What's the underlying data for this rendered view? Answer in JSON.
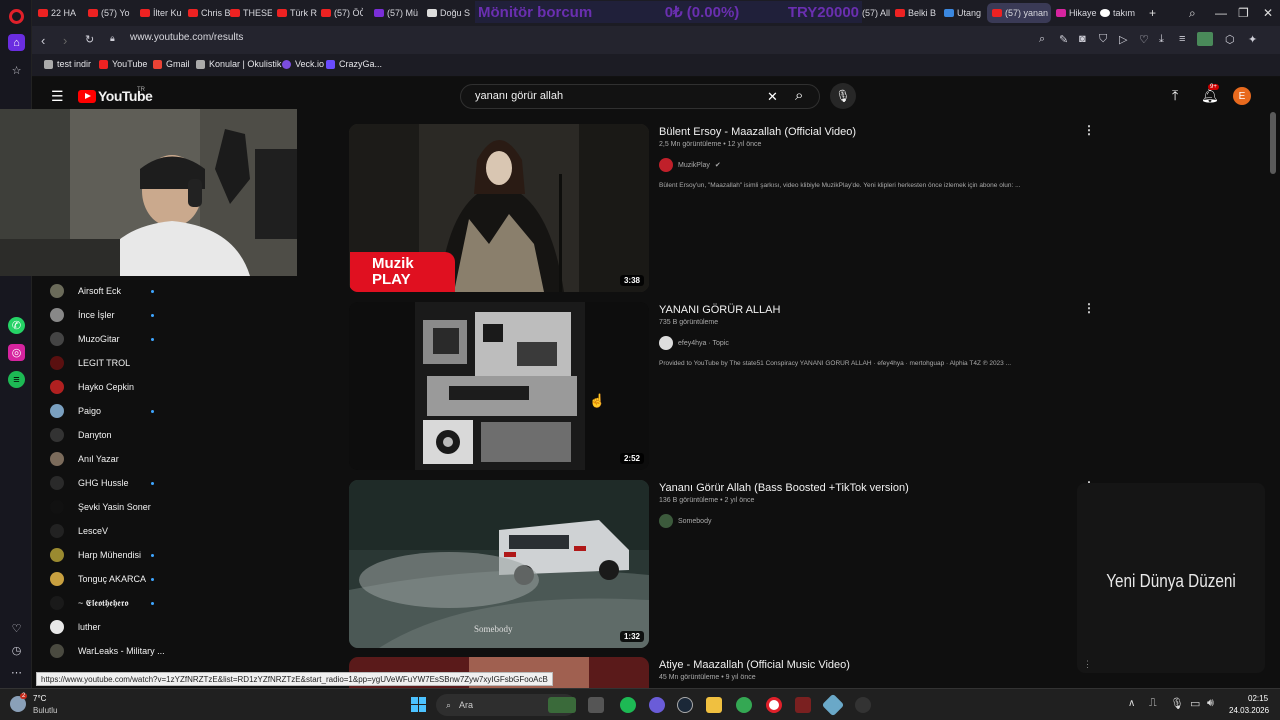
{
  "browser": {
    "tabs": [
      {
        "label": "22 HA"
      },
      {
        "label": "(57) Yo"
      },
      {
        "label": "İlter Ku"
      },
      {
        "label": "Chris B"
      },
      {
        "label": "THESE"
      },
      {
        "label": "Türk R"
      },
      {
        "label": "(57) ÖĞ"
      },
      {
        "label": "(57) Mü"
      },
      {
        "label": "Doğu S"
      },
      {
        "label": "(57) All"
      },
      {
        "label": "Belki B"
      },
      {
        "label": "Utang"
      },
      {
        "label": "(57) yanan"
      },
      {
        "label": "Hikaye"
      },
      {
        "label": "takım"
      }
    ],
    "ticker": {
      "left": "Mönitör borcum",
      "middle": "0₺ (0.00%)",
      "right": "TRY20000"
    },
    "url": "www.youtube.com/results",
    "bookmarks": [
      "test indir",
      "YouTube",
      "Gmail",
      "Konular | Okulistik",
      "Veck.io",
      "CrazyGa..."
    ]
  },
  "youtube": {
    "logo_text": "YouTube",
    "country": "TR",
    "search": {
      "value": "yananı görür allah",
      "placeholder": "Ara"
    },
    "avatar_letter": "E",
    "notif_count": "9+"
  },
  "subscriptions": [
    {
      "name": "Airsoft Eck",
      "new": true
    },
    {
      "name": "İnce İşler",
      "new": true
    },
    {
      "name": "MuzoGitar",
      "new": true
    },
    {
      "name": "LEGIT TROL",
      "new": false
    },
    {
      "name": "Hayko Cepkin",
      "new": false
    },
    {
      "name": "Paigo",
      "new": true
    },
    {
      "name": "Danyton",
      "new": false
    },
    {
      "name": "Anıl Yazar",
      "new": false
    },
    {
      "name": "GHG Hussle",
      "new": true
    },
    {
      "name": "Şevki Yasin Soner",
      "new": false
    },
    {
      "name": "LesceV",
      "new": false
    },
    {
      "name": "Harp Mühendisi",
      "new": true
    },
    {
      "name": "Tonguç AKARCA",
      "new": true
    },
    {
      "name": "~ 𝕰𝖑𝖊𝖔𝖙𝖍𝖊𝖍𝖊𝖗𝖔",
      "new": true
    },
    {
      "name": "luther",
      "new": false
    },
    {
      "name": "WarLeaks - Military ...",
      "new": false
    }
  ],
  "results": [
    {
      "title": "Bülent Ersoy - Maazallah (Official Video)",
      "meta": "2,5 Mn görüntüleme • 12 yıl önce",
      "channel": "MuzikPlay",
      "desc": "Bülent Ersoy'un, \"Maazallah\" isimli şarkısı, video klibiyle MuzikPlay'de. Yeni klipleri herkesten önce izlemek için abone olun: ...",
      "duration": "3:38",
      "thumb_badge": "Muzik PLAY"
    },
    {
      "title": "YANANI GÖRÜR ALLAH",
      "meta": "735 B görüntüleme",
      "channel": "efey4hya · Topic",
      "desc": "Provided to YouTube by The state51 Conspiracy YANANI GÖRÜR ALLAH · efey4hya · mertohguap · Alphia T4Z ℗ 2023 ...",
      "duration": "2:52"
    },
    {
      "title": "Yananı Görür Allah (Bass Boosted +TikTok version)",
      "meta": "136 B görüntüleme • 2 yıl önce",
      "channel": "Somebody",
      "desc": "",
      "duration": "1:32",
      "thumb_caption": "Somebody"
    },
    {
      "title": "Atiye - Maazallah (Official Music Video)",
      "meta": "45 Mn görüntüleme • 9 yıl önce"
    }
  ],
  "side_panel": {
    "text": "Yeni Dünya Düzeni"
  },
  "status_url": "https://www.youtube.com/watch?v=1zYZfNRZTzE&list=RD1zYZfNRZTzE&start_radio=1&pp=ygUVeWFuYW7EsSBnw7Zyw7xyIGFsbGFooAcB",
  "taskbar": {
    "weather_temp": "7°C",
    "weather_desc": "Bulutlu",
    "weather_badge": "2",
    "search_placeholder": "Ara",
    "time": "02:15",
    "date": "24.03.2026"
  }
}
